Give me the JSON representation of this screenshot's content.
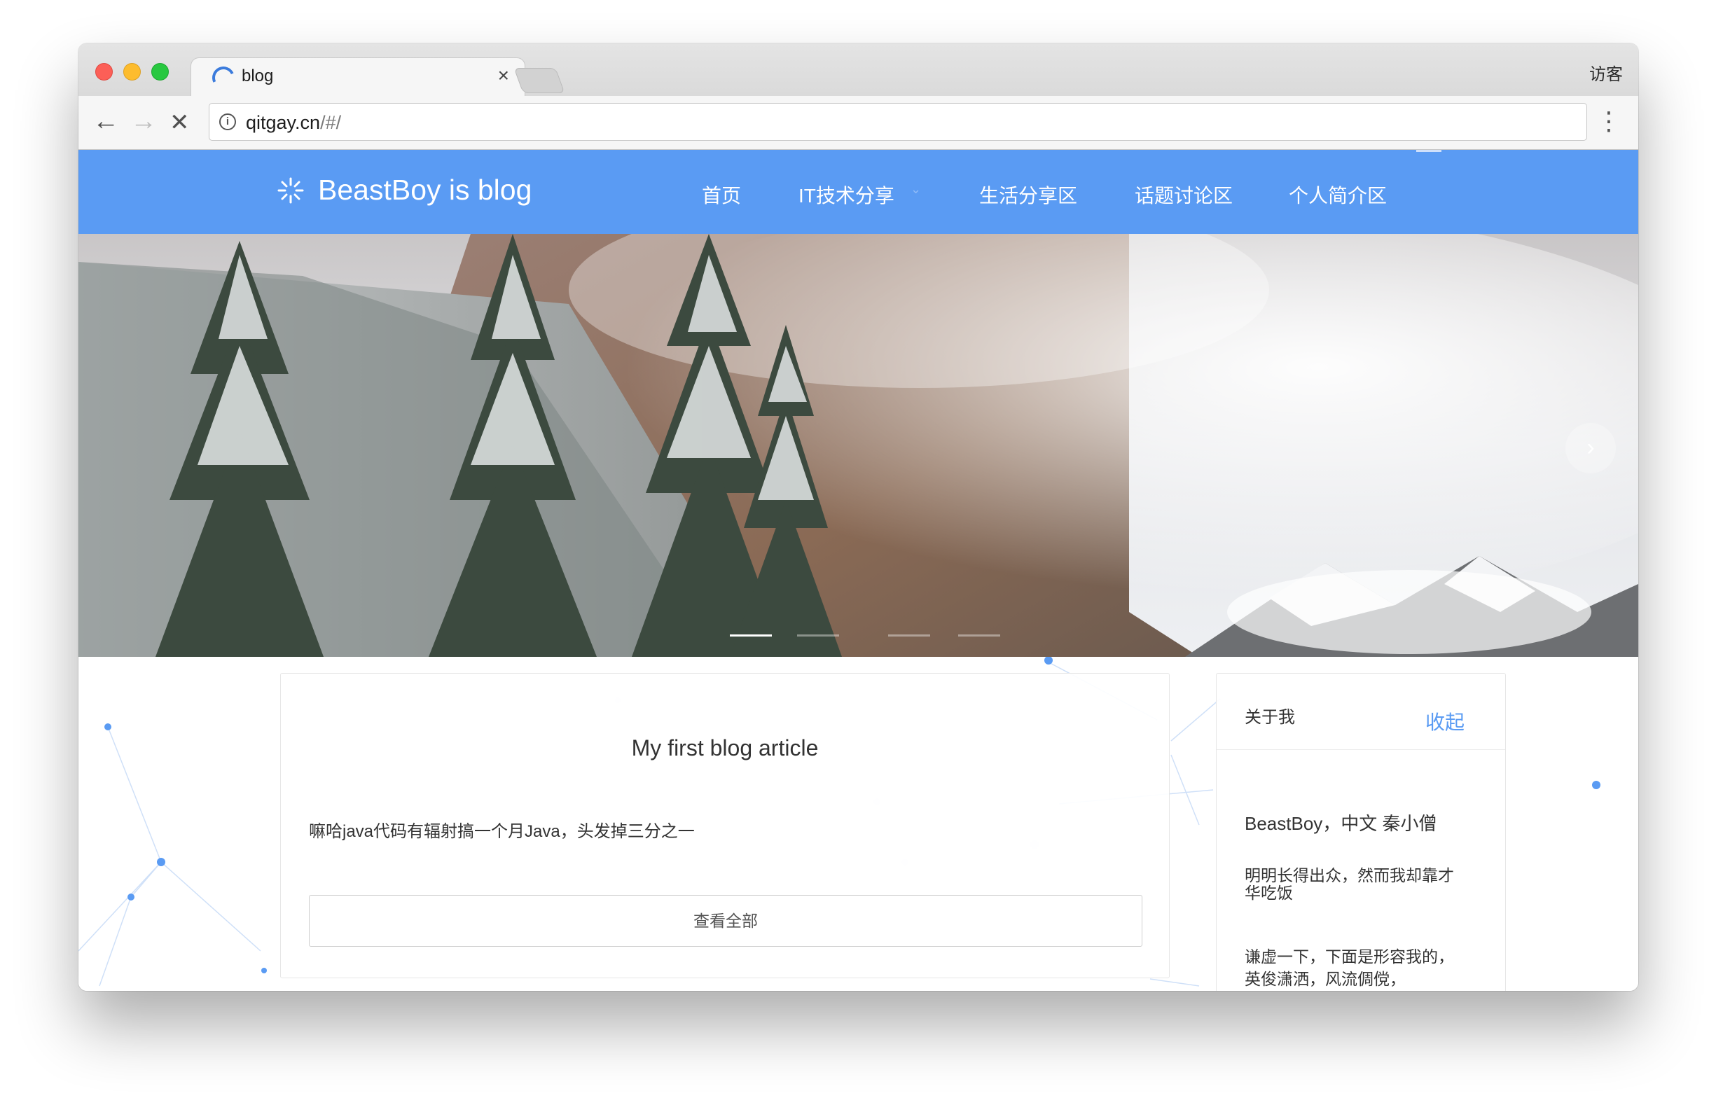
{
  "browser": {
    "tab_title": "blog",
    "tab_close": "×",
    "profile": "访客",
    "url_host": "qitgay.cn",
    "url_path": "/#/",
    "back_glyph": "←",
    "forward_glyph": "→",
    "stop_glyph": "✕",
    "menu_glyph": "⋮",
    "info_glyph": "i"
  },
  "site": {
    "logo_text": "BeastBoy is blog",
    "nav": [
      "首页",
      "IT技术分享",
      "生活分享区",
      "话题讨论区",
      "个人简介区"
    ],
    "nav_caret": "⌄",
    "brand_color": "#5a9bf3"
  },
  "carousel": {
    "next_glyph": "›",
    "slide_count": 4,
    "active_slide": 1
  },
  "article": {
    "title": "My first blog article",
    "excerpt": "嘛哈java代码有辐射搞一个月Java，头发掉三分之一",
    "button": "查看全部"
  },
  "sidebar": {
    "title": "关于我",
    "toggle": "收起",
    "name": "BeastBoy，中文 秦小僧",
    "p1": "明明长得出众，然而我却靠才华吃饭",
    "p2": "谦虚一下，下面是形容我的，英俊潇洒，风流倜傥，"
  }
}
